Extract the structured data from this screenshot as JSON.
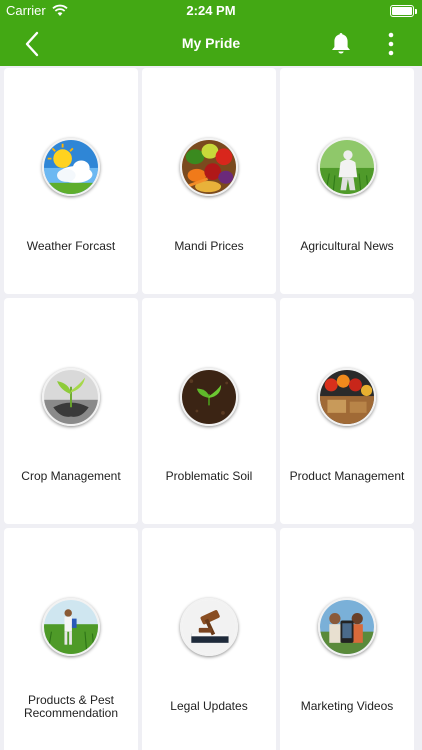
{
  "status_bar": {
    "carrier": "Carrier",
    "time": "2:24 PM"
  },
  "nav": {
    "title": "My Pride"
  },
  "colors": {
    "brand": "#43a814",
    "background": "#efeff4"
  },
  "tiles": [
    {
      "label": "Weather Forcast",
      "icon": "weather-icon"
    },
    {
      "label": "Mandi Prices",
      "icon": "vegetables-icon"
    },
    {
      "label": "Agricultural News",
      "icon": "farmer-field-icon"
    },
    {
      "label": "Crop Management",
      "icon": "seedling-icon"
    },
    {
      "label": "Problematic Soil",
      "icon": "soil-plant-icon"
    },
    {
      "label": "Product Management",
      "icon": "produce-basket-icon"
    },
    {
      "label": "Products & Pest Recommendation",
      "icon": "farmer-spraying-icon"
    },
    {
      "label": "Legal Updates",
      "icon": "gavel-icon"
    },
    {
      "label": "Marketing Videos",
      "icon": "video-icon"
    }
  ]
}
